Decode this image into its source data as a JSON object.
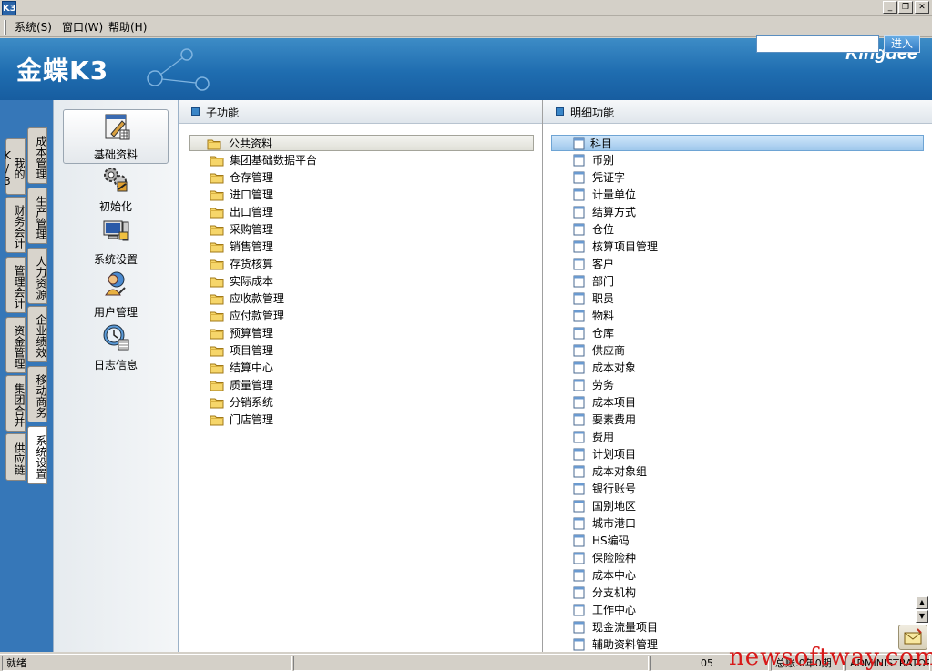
{
  "window": {
    "title_icon": "K3"
  },
  "menu": [
    "系统(S)",
    "窗口(W)",
    "帮助(H)"
  ],
  "header": {
    "logo": "金蝶K3",
    "brand": "Kingdee",
    "search_placeholder": "",
    "enter_label": "进入"
  },
  "left_tabs_outer": [
    {
      "label": "我的K/3"
    },
    {
      "label": "财务会计"
    },
    {
      "label": "管理会计"
    },
    {
      "label": "资金管理"
    },
    {
      "label": "集团合并"
    },
    {
      "label": "供应链"
    }
  ],
  "left_tabs_inner": [
    {
      "label": "成本管理"
    },
    {
      "label": "生产管理"
    },
    {
      "label": "人力资源"
    },
    {
      "label": "企业绩效"
    },
    {
      "label": "移动商务"
    },
    {
      "label": "系统设置",
      "active": true
    }
  ],
  "modules": [
    {
      "label": "基础资料",
      "icon": "basic-data-icon",
      "selected": true
    },
    {
      "label": "初始化",
      "icon": "initialize-gears-icon"
    },
    {
      "label": "系统设置",
      "icon": "system-settings-computer-icon"
    },
    {
      "label": "用户管理",
      "icon": "user-management-icon"
    },
    {
      "label": "日志信息",
      "icon": "log-clock-icon"
    }
  ],
  "sub_panel": {
    "header": "子功能",
    "items": [
      "公共资料",
      "集团基础数据平台",
      "仓存管理",
      "进口管理",
      "出口管理",
      "采购管理",
      "销售管理",
      "存货核算",
      "实际成本",
      "应收款管理",
      "应付款管理",
      "预算管理",
      "项目管理",
      "结算中心",
      "质量管理",
      "分销系统",
      "门店管理"
    ]
  },
  "detail_panel": {
    "header": "明细功能",
    "items": [
      "科目",
      "币别",
      "凭证字",
      "计量单位",
      "结算方式",
      "仓位",
      "核算项目管理",
      "客户",
      "部门",
      "职员",
      "物料",
      "仓库",
      "供应商",
      "成本对象",
      "劳务",
      "成本项目",
      "要素费用",
      "费用",
      "计划项目",
      "成本对象组",
      "银行账号",
      "国别地区",
      "城市港口",
      "HS编码",
      "保险险种",
      "成本中心",
      "分支机构",
      "工作中心",
      "现金流量项目",
      "辅助资料管理"
    ]
  },
  "status": {
    "ready": "就绪",
    "code": "05",
    "period": "总账:0年0期",
    "user": "ADMINISTRATOR"
  },
  "watermark": "newsoftway.com"
}
